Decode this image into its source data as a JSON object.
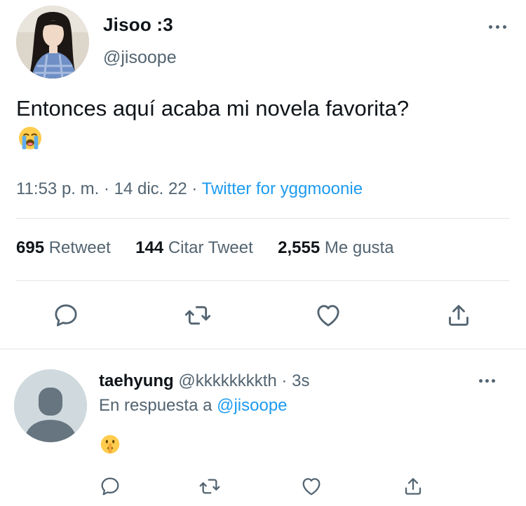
{
  "tweet": {
    "author_name": "Jisoo :3",
    "author_handle": "@jisoope",
    "text": "Entonces aquí acaba mi novela favorita?",
    "emoji": "sob-emoji",
    "time": "11:53 p. m.",
    "date": "14 dic. 22",
    "separator": "·",
    "source": "Twitter for yggmoonie"
  },
  "stats": {
    "retweets_count": "695",
    "retweets_label": "Retweet",
    "quotes_count": "144",
    "quotes_label": "Citar Tweet",
    "likes_count": "2,555",
    "likes_label": "Me gusta"
  },
  "actions": {
    "reply_icon": "reply-icon",
    "retweet_icon": "retweet-icon",
    "like_icon": "heart-icon",
    "share_icon": "share-icon"
  },
  "reply": {
    "author_name": "taehyung",
    "author_handle": "@kkkkkkkkth",
    "separator": "·",
    "time": "3s",
    "replying_to_label": "En respuesta a",
    "replying_to_handle": "@jisoope",
    "emoji": "shushing-face-emoji"
  },
  "colors": {
    "accent": "#1d9bf0",
    "secondary_text": "#536471",
    "primary_text": "#0f1419",
    "divider": "#e2e6e9"
  }
}
